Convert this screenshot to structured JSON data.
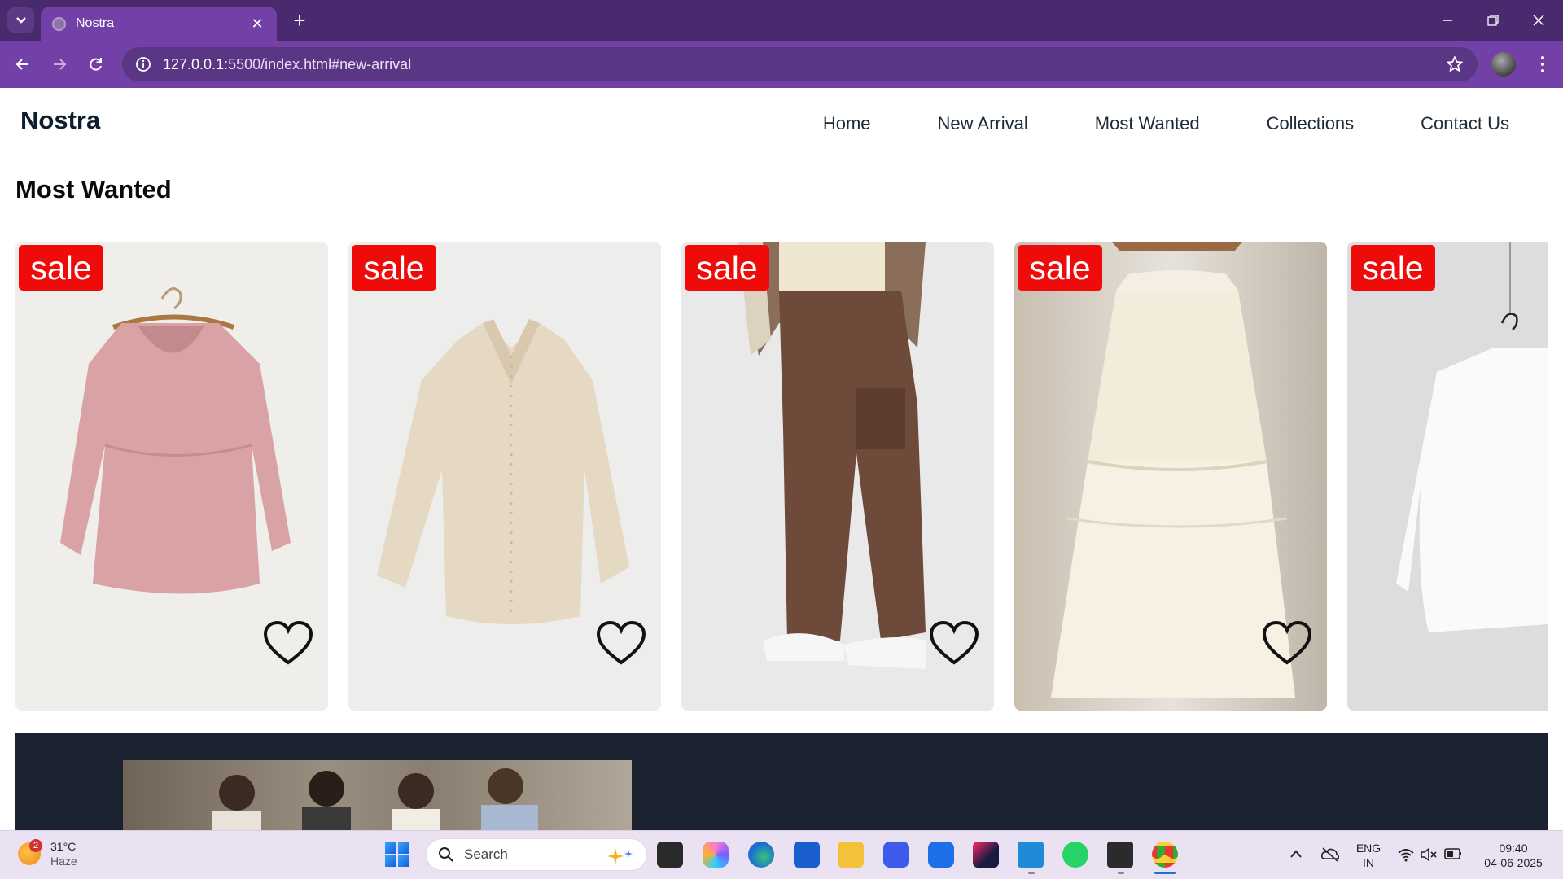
{
  "browser": {
    "tab_title": "Nostra",
    "url_host": "127.0.0.1",
    "url_rest": ":5500/index.html#new-arrival"
  },
  "site": {
    "brand": "Nostra",
    "nav": [
      "Home",
      "New Arrival",
      "Most Wanted",
      "Collections",
      "Contact Us"
    ],
    "section_title": "Most Wanted",
    "sale_label": "sale",
    "products": [
      {
        "item": "pink dress"
      },
      {
        "item": "cream blouse"
      },
      {
        "item": "brown cargo pants"
      },
      {
        "item": "ivory tiered skirt"
      },
      {
        "item": "white shirt"
      }
    ]
  },
  "taskbar": {
    "weather_temp": "31°C",
    "weather_desc": "Haze",
    "weather_badge": "2",
    "search_label": "Search",
    "lang_top": "ENG",
    "lang_bottom": "IN",
    "time": "09:40",
    "date": "04-06-2025"
  },
  "colors": {
    "tabbar": "#4a2a6e",
    "toolbar": "#7340a8",
    "sale_badge": "#f00b0b",
    "banner": "#1b2330"
  }
}
